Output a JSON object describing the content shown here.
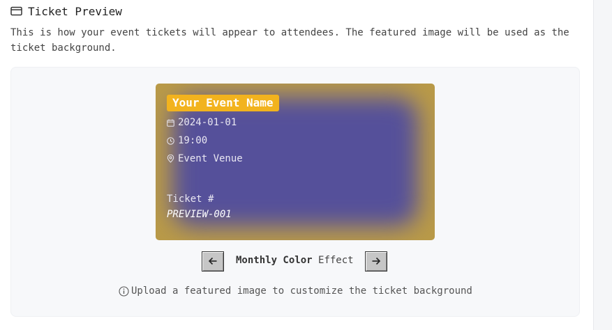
{
  "section": {
    "icon": "ticket-card-icon",
    "title": "Ticket Preview",
    "description": "This is how your event tickets will appear to attendees. The featured image will be used as the ticket background."
  },
  "ticket": {
    "event_name": "Your Event Name",
    "date_icon": "calendar-icon",
    "date": "2024-01-01",
    "time_icon": "clock-icon",
    "time": "19:00",
    "venue_icon": "map-pin-icon",
    "venue": "Event Venue",
    "number_label": "Ticket #",
    "number": "PREVIEW-001",
    "colors": {
      "background": "#b99a48",
      "glow": "#55509a",
      "name_badge": "#f2b31e"
    }
  },
  "effect": {
    "prev_icon": "arrow-left-icon",
    "next_icon": "arrow-right-icon",
    "name_bold": "Monthly Color",
    "name_rest": "Effect"
  },
  "hint": {
    "icon": "info-icon",
    "text": "Upload a featured image to customize the ticket background"
  }
}
